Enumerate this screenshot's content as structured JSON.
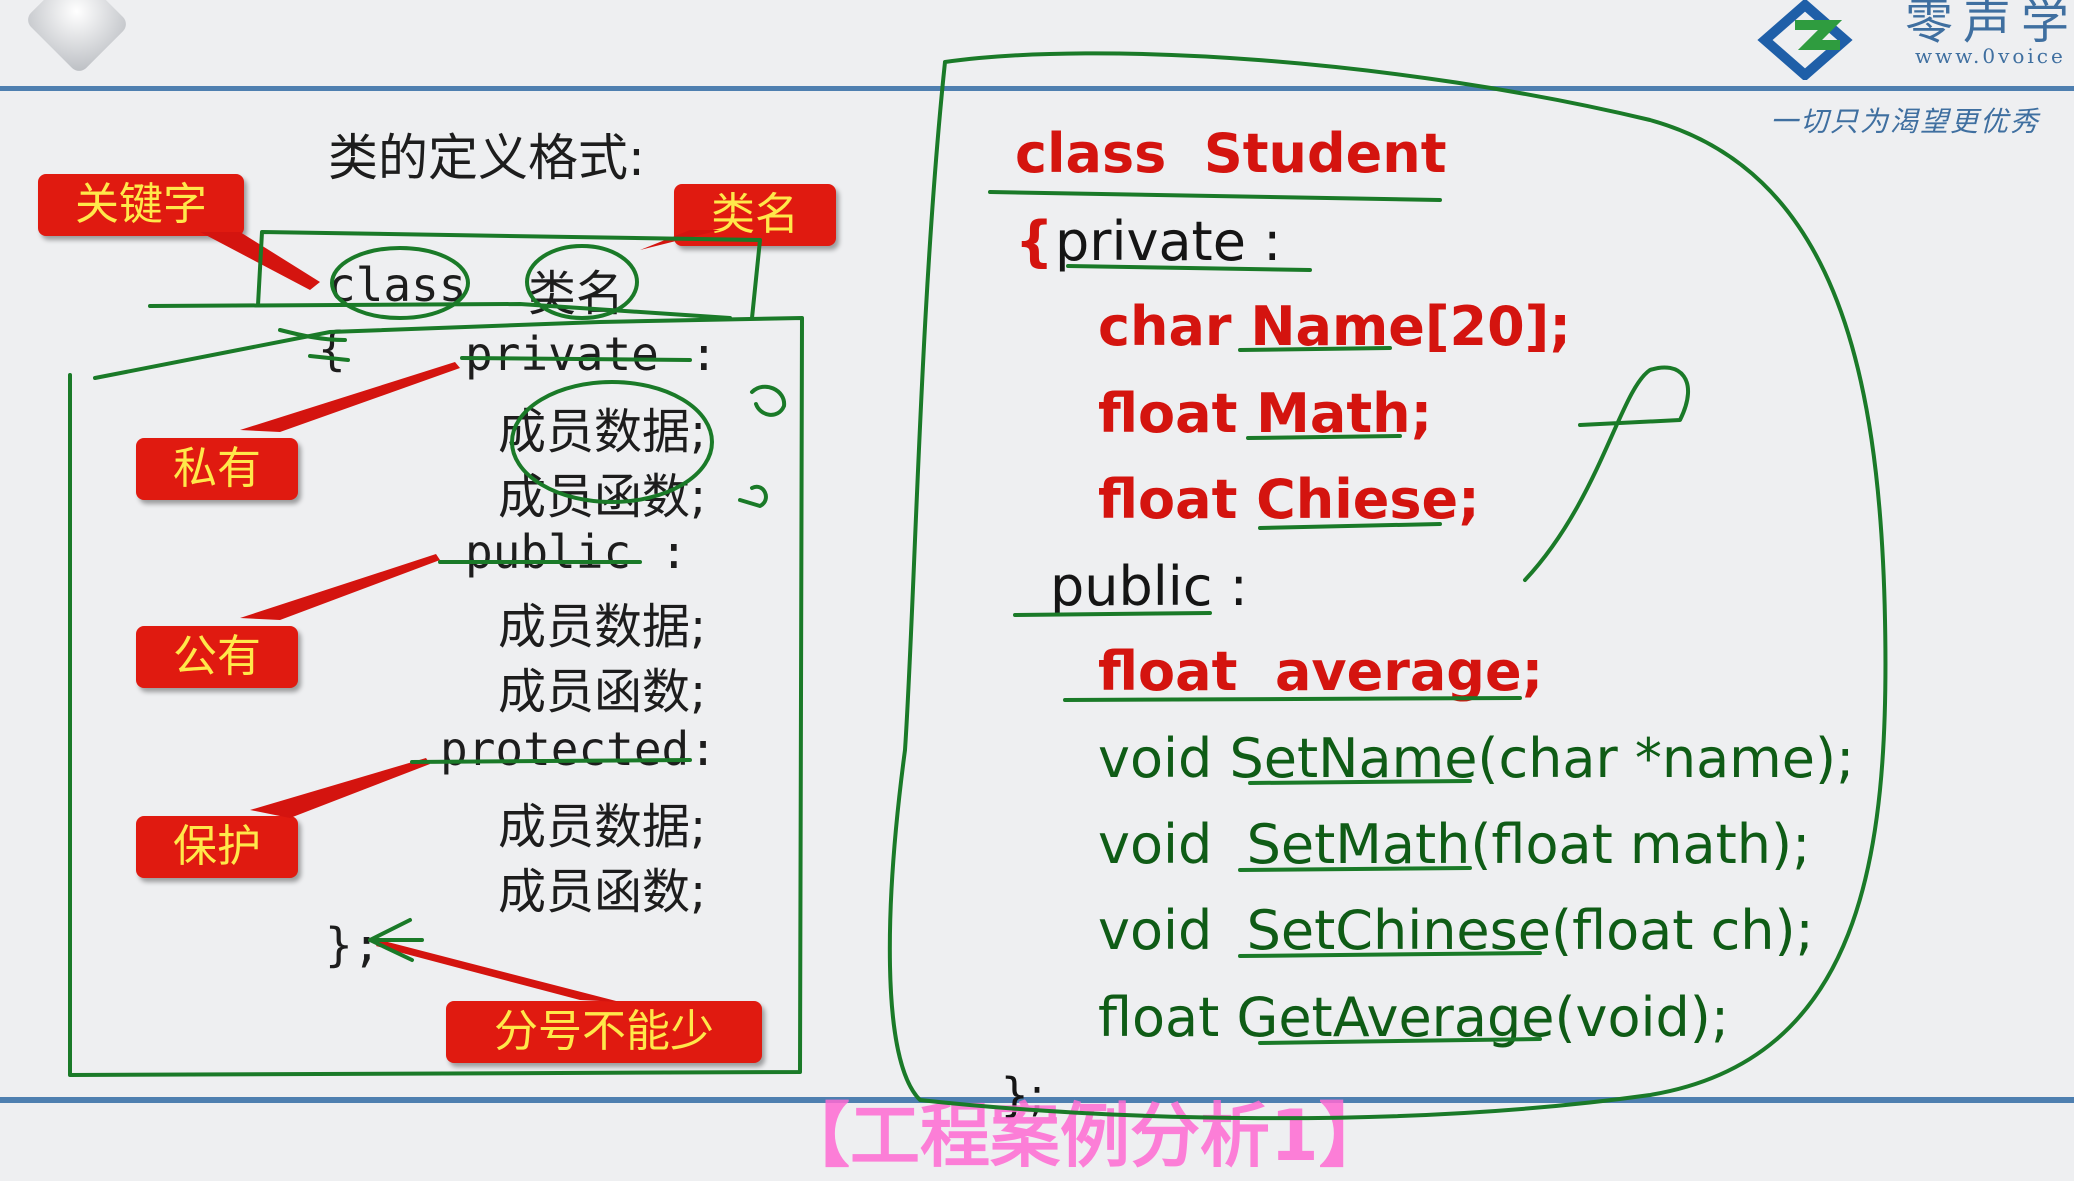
{
  "brand": {
    "name": "零声学",
    "url": "www.0voice",
    "slogan": "一切只为渴望更优秀",
    "colors": {
      "blue": "#1f5fa8",
      "green": "#2f9c3f"
    }
  },
  "left_panel": {
    "title": "类的定义格式:",
    "tags": {
      "keyword": "关键字",
      "classname": "类名",
      "private": "私有",
      "public": "公有",
      "protected": "保护",
      "semicolon": "分号不能少"
    },
    "lines": {
      "class_kw": "class",
      "class_name": "类名",
      "open_brace": "{",
      "private": "private",
      "private_colon": ":",
      "private_data": "成员数据;",
      "private_func": "成员函数;",
      "public": "public",
      "public_colon": ":",
      "public_data": "成员数据;",
      "public_func": "成员函数;",
      "protected": "protected:",
      "protected_data": "成员数据;",
      "protected_func": "成员函数;",
      "close": "};"
    }
  },
  "code": {
    "line1": "class  Student",
    "line2_brace": "{",
    "line2_kw": "private :",
    "line3": "char Name[20];",
    "line4": "float Math;",
    "line5": "float Chiese;",
    "line6": "public :",
    "line7": "float  average;",
    "line8": "void SetName(char *name);",
    "line9": "void  SetMath(float math);",
    "line10": "void  SetChinese(float ch);",
    "line11": "float GetAverage(void);",
    "line12": "};"
  },
  "footer": "【工程案例分析1】"
}
